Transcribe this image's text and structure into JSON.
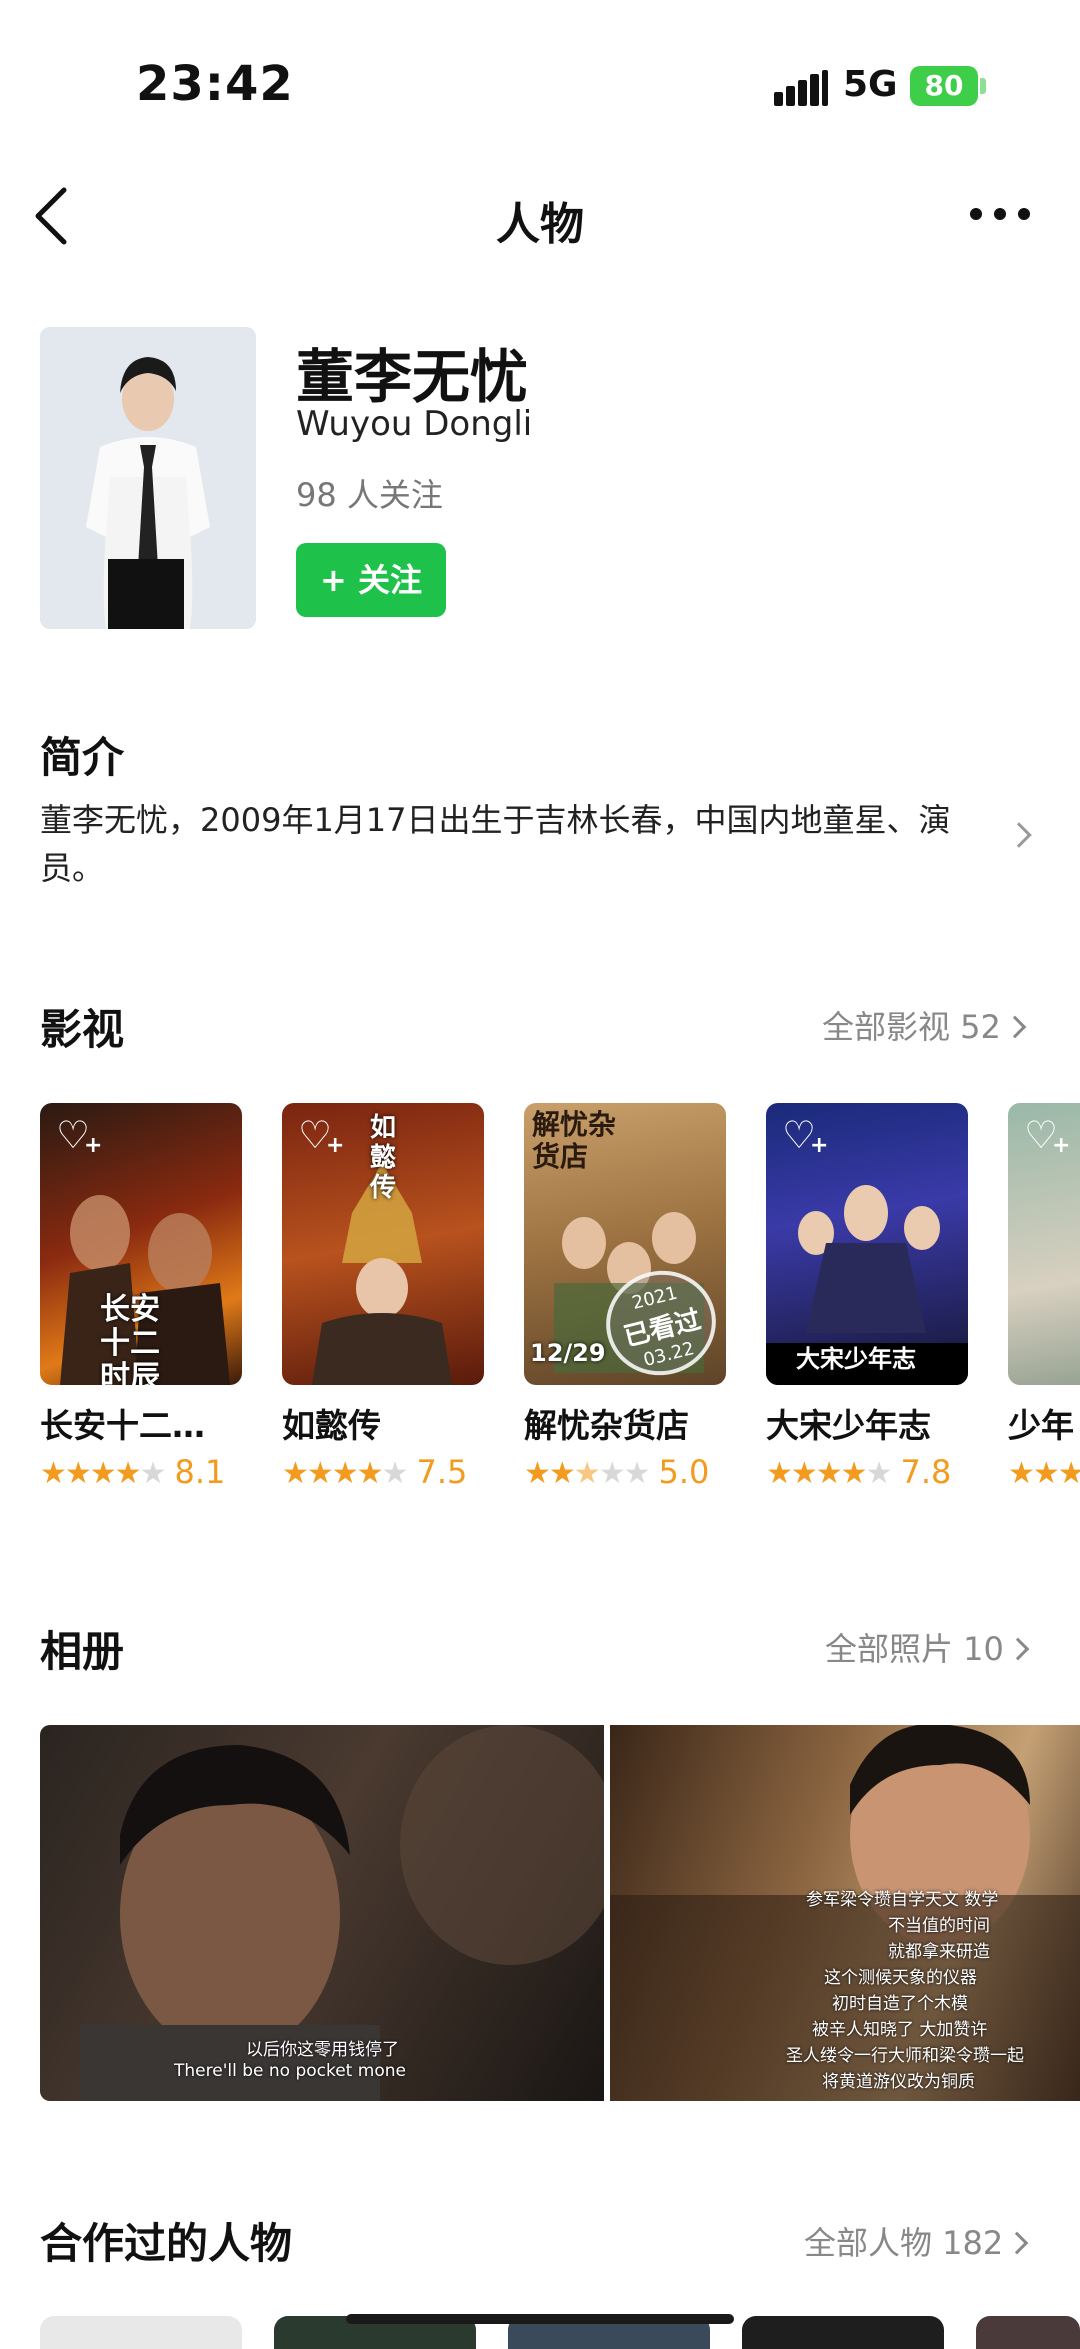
{
  "status": {
    "time": "23:42",
    "network": "5G",
    "battery": "80"
  },
  "nav": {
    "title": "人物"
  },
  "profile": {
    "name": "董李无忧",
    "name_en": "Wuyou Dongli",
    "followers": "98 人关注",
    "follow_label": "+ 关注"
  },
  "bio": {
    "title": "简介",
    "text": "董李无忧，2009年1月17日出生于吉林长春，中国内地童星、演员。"
  },
  "films": {
    "title": "影视",
    "more": "全部影视 52",
    "items": [
      {
        "title": "长安十二…",
        "rating": 4,
        "score": "8.1",
        "poster_text": "长安十二时辰"
      },
      {
        "title": "如懿传",
        "rating": 4,
        "score": "7.5",
        "poster_text": "如懿传"
      },
      {
        "title": "解忧杂货店",
        "rating": 2.5,
        "score": "5.0",
        "poster_text": "解忧杂货店",
        "poster_date": "12/29",
        "stamp_year": "2021",
        "stamp_text": "已看过",
        "stamp_date": "03.22"
      },
      {
        "title": "大宋少年志",
        "rating": 4,
        "score": "7.8",
        "poster_text": "大宋少年志"
      },
      {
        "title": "少年",
        "rating": 3,
        "score": ""
      }
    ]
  },
  "album": {
    "title": "相册",
    "more": "全部照片 10",
    "photo1_subtitle_cn": "以后你这零用钱停了",
    "photo1_subtitle_en": "There'll be no pocket mone",
    "photo2_subtitles": [
      "参军梁令瓒自学天文 数学",
      "不当值的时间",
      "就都拿来研造",
      "这个测候天象的仪器",
      "初时自造了个木模",
      "被辛人知晓了 大加赞许",
      "圣人缕令一行大师和梁令瓒一起",
      "将黄道游仪改为铜质"
    ]
  },
  "people": {
    "title": "合作过的人物",
    "more": "全部人物 182"
  },
  "colors": {
    "accent": "#1ec14a",
    "star": "#f29b1f",
    "battery": "#3fce4a"
  }
}
